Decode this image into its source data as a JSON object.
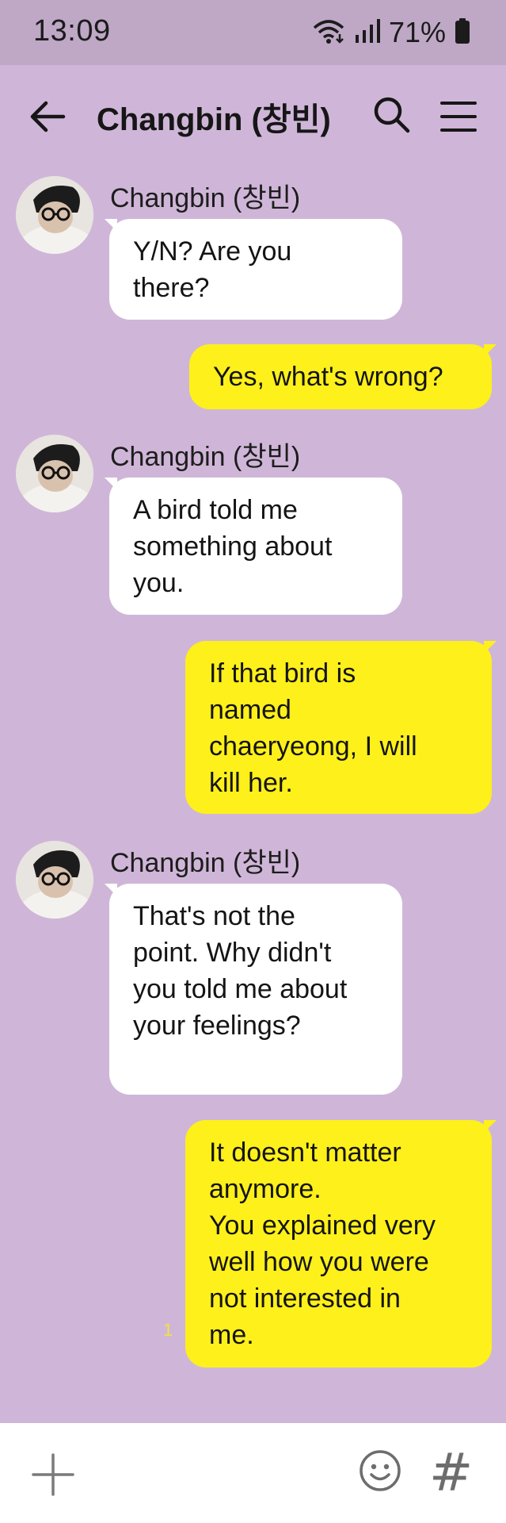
{
  "status_bar": {
    "time": "13:09",
    "battery": "71%",
    "icons": [
      "wifi-icon",
      "signal-icon",
      "battery-icon"
    ]
  },
  "header": {
    "title": "Changbin (창빈)",
    "icons": [
      "back-arrow-icon",
      "search-icon",
      "menu-icon"
    ]
  },
  "messages": [
    {
      "type": "in",
      "sender": "Changbin (창빈)",
      "lines": [
        "Y/N? Are you",
        "there?"
      ]
    },
    {
      "type": "out",
      "lines": [
        "Yes, what's wrong?"
      ]
    },
    {
      "type": "in",
      "sender": "Changbin (창빈)",
      "lines": [
        "A bird told me",
        "something about",
        "you."
      ]
    },
    {
      "type": "out",
      "lines": [
        "If that bird is",
        "named",
        "chaeryeong, I will",
        "kill her."
      ]
    },
    {
      "type": "in",
      "sender": "Changbin (창빈)",
      "lines": [
        "That's not the",
        "point. Why didn't",
        "you told me about",
        "your feelings?"
      ]
    },
    {
      "type": "out",
      "unread": "1",
      "lines": [
        "It doesn't matter",
        "anymore.",
        "You explained very",
        "well how you were",
        "not interested in",
        "me."
      ]
    }
  ],
  "input_bar": {
    "icons": [
      "plus-icon",
      "emoji-icon",
      "hashtag-icon"
    ],
    "hash_glyph": "#"
  },
  "colors": {
    "background": "#cfb6d8",
    "status_bar": "#bea8c6",
    "incoming_bubble": "#ffffff",
    "outgoing_bubble": "#fef01b"
  }
}
